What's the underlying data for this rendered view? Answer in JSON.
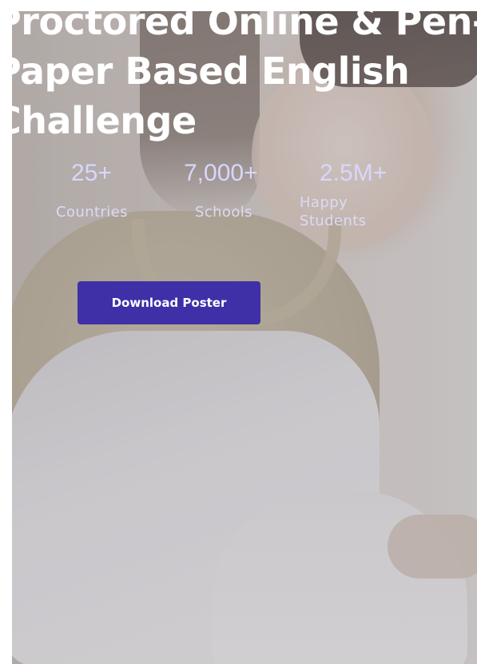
{
  "hero": {
    "headline_lines": [
      "Proctored Online & Pen-",
      "Paper Based English",
      "Challenge"
    ],
    "stats": [
      {
        "value": "25+",
        "label": "Countries"
      },
      {
        "value": "7,000+",
        "label": "Schools"
      },
      {
        "value": "2.5M+",
        "label": "Happy Students"
      }
    ],
    "cta_label": "Download Poster",
    "colors": {
      "accent": "#3f30a8",
      "stat_text": "#d9d6ff",
      "headline_text": "#ffffff"
    }
  }
}
